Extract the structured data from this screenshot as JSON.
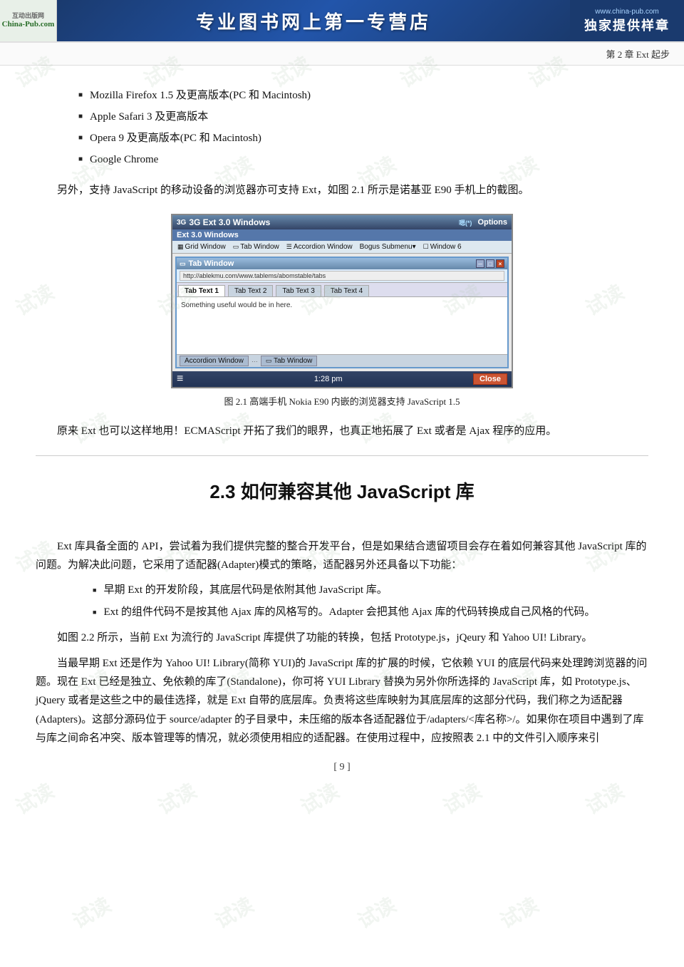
{
  "header": {
    "logo_top": "互动出版网",
    "logo_sub": "China-Pub.com",
    "center_text": "专业图书网上第一专营店",
    "right_url": "www.china-pub.com",
    "right_text": "独家提供样章"
  },
  "chapter_bar": {
    "text": "第 2 章    Ext 起步"
  },
  "bullet_items": [
    "Mozilla Firefox 1.5 及更高版本(PC 和 Macintosh)",
    "Apple Safari 3 及更高版本",
    "Opera 9 及更高版本(PC 和 Macintosh)",
    "Google Chrome"
  ],
  "paragraph1": "另外，支持 JavaScript 的移动设备的浏览器亦可支持 Ext，如图 2.1 所示是诺基亚 E90 手机上的截图。",
  "figure": {
    "caption": "图 2.1    高端手机 Nokia E90 内嵌的浏览器支持 JavaScript 1.5",
    "nokia_title": "3G Ext 3.0 Windows",
    "signal": "嗯(*)",
    "options": "Options",
    "menu_title": "Ext 3.0 Windows",
    "toolbar_items": [
      "Grid Window",
      "Tab Window",
      "Accordion Window",
      "Bogus Submenu▾",
      "Window 6"
    ],
    "win_title": "Tab Window",
    "url": "http://ablekmu.com/www.tablems/abomstable/tabs",
    "tab1": "Tab Text 1",
    "tab2": "Tab Text 2",
    "tab3": "Tab Text 3",
    "tab4": "Tab Text 4",
    "content_text": "Something useful would be in here.",
    "bottom1": "Accordion Window",
    "bottom2": "Tab Window",
    "time": "1:28 pm",
    "close_btn": "Close"
  },
  "paragraph2": "原来 Ext 也可以这样地用！ECMAScript 开拓了我们的眼界，也真正地拓展了 Ext 或者是 Ajax 程序的应用。",
  "section_title": "2.3    如何兼容其他 JavaScript 库",
  "paragraph3": "Ext 库具备全面的 API，尝试着为我们提供完整的整合开发平台，但是如果结合遗留项目会存在着如何兼容其他 JavaScript 库的问题。为解决此问题，它采用了适配器(Adapter)模式的策略，适配器另外还具备以下功能：",
  "sub_bullets": [
    "早期 Ext 的开发阶段，其底层代码是依附其他 JavaScript 库。",
    "Ext 的组件代码不是按其他 Ajax 库的风格写的。Adapter 会把其他 Ajax 库的代码转换成自己风格的代码。"
  ],
  "paragraph4": "如图 2.2 所示，当前 Ext 为流行的 JavaScript 库提供了功能的转换，包括 Prototype.js，jQeury 和 Yahoo UI! Library。",
  "paragraph5": "当最早期 Ext 还是作为 Yahoo UI! Library(简称 YUI)的 JavaScript 库的扩展的时候，它依赖 YUI 的底层代码来处理跨浏览器的问题。现在 Ext 已经是独立、免依赖的库了(Standalone)，你可将 YUI Library 替换为另外你所选择的 JavaScript 库，如 Prototype.js、jQuery 或者是这些之中的最佳选择，就是 Ext 自带的底层库。负责将这些库映射为其底层库的这部分代码，我们称之为适配器(Adapters)。这部分源码位于 source/adapter 的子目录中，未压缩的版本各适配器位于/adapters/<库名称>/。如果你在项目中遇到了库与库之间命名冲突、版本管理等的情况，就必须使用相应的适配器。在使用过程中，应按照表 2.1 中的文件引入顺序来引",
  "page_number": "[ 9 ]",
  "watermark_text": "试读"
}
